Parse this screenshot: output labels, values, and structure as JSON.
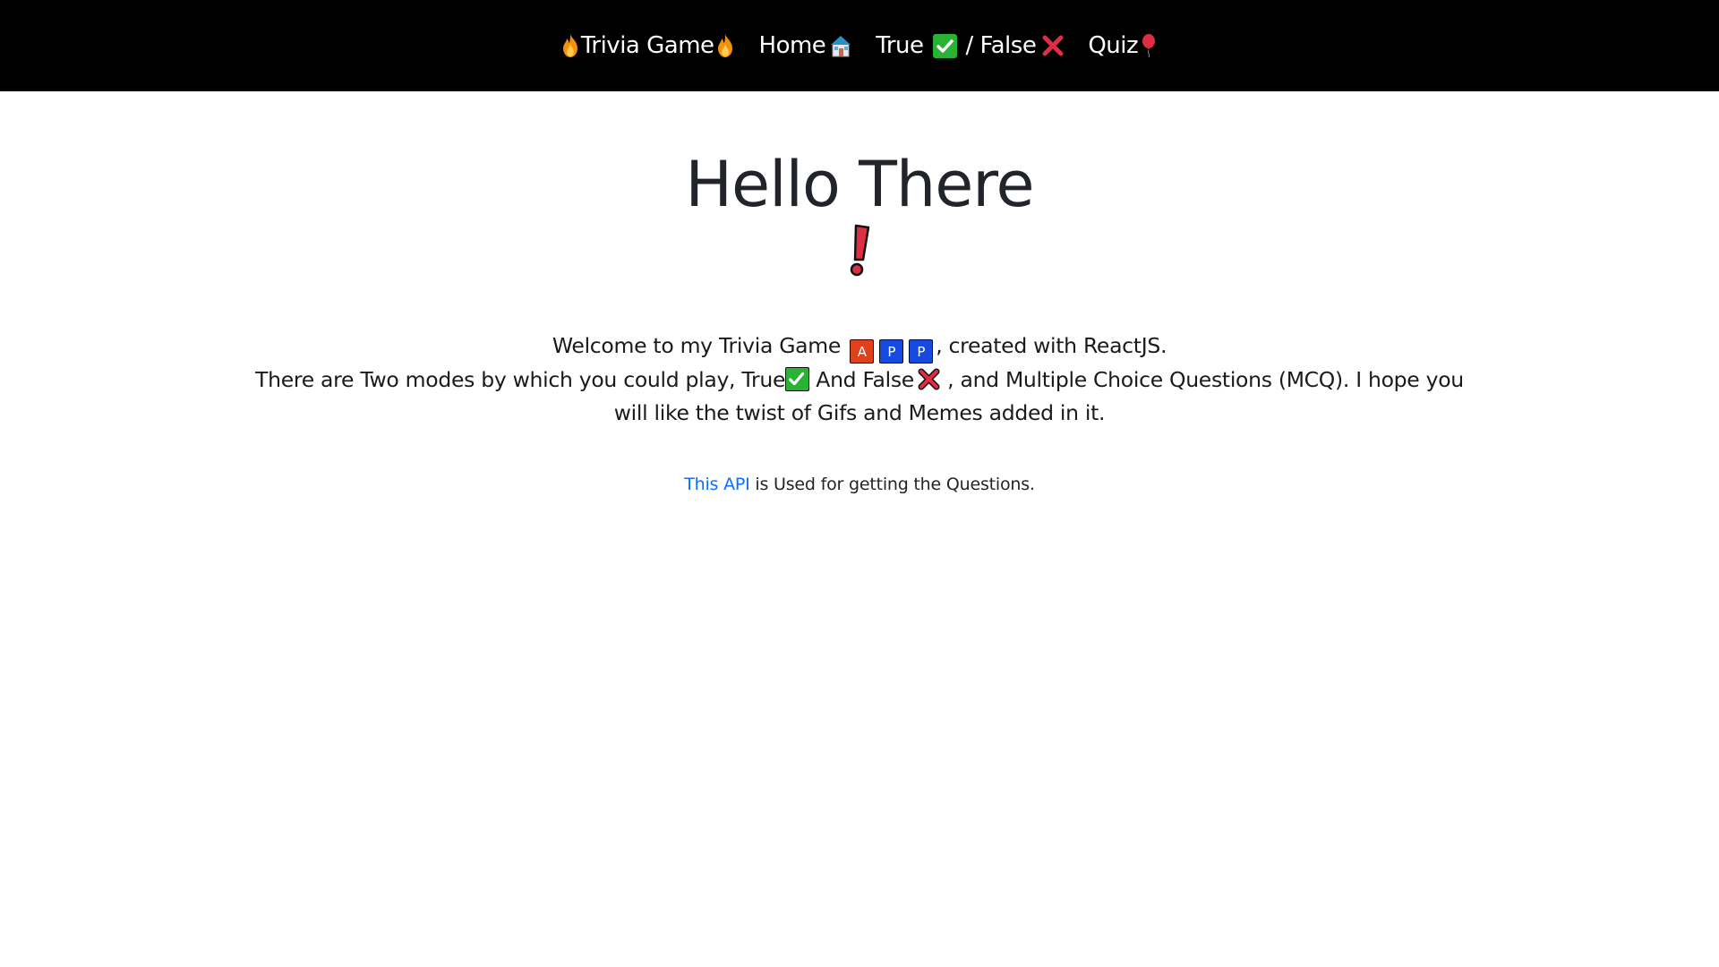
{
  "navbar": {
    "brand": "Trivia Game",
    "links": [
      {
        "label": "Home",
        "icon": "house-icon"
      },
      {
        "label": "True",
        "icon": "check-mark-icon"
      },
      {
        "label": "/ False",
        "icon": "cross-mark-icon"
      },
      {
        "label": "Quiz",
        "icon": "balloon-icon"
      }
    ],
    "brand_icon": "fire-icon"
  },
  "main": {
    "title": "Hello There",
    "title_icon": "exclamation-icon",
    "intro_line1_prefix": "Welcome to my Trivia Game",
    "app_letters": [
      "A",
      "P",
      "P"
    ],
    "intro_line1_suffix": ", created with ReactJS.",
    "intro_line2_part1": "There are Two modes by which you could play, True",
    "intro_line2_part2": " And False",
    "intro_line2_part3": " , and Multiple Choice Questions (MCQ). I hope you will like the twist of Gifs and Memes added in it.",
    "api_link_text": "This API",
    "api_line_suffix": " is Used for getting the Questions."
  },
  "colors": {
    "navbar_bg": "#000000",
    "link": "#0d6efd",
    "check_green": "#29b233",
    "cross_red": "#e0401b",
    "letter_blue": "#1549e0"
  }
}
